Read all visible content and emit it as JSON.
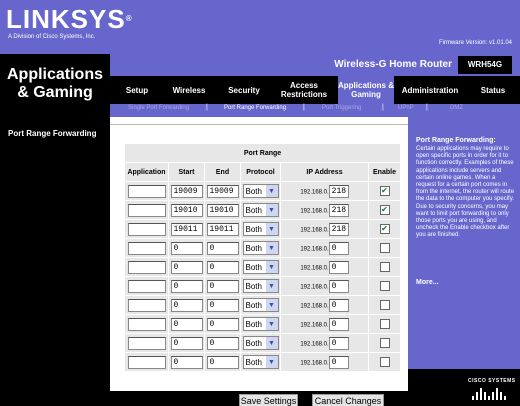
{
  "brand": {
    "logo_text": "LINKSYS",
    "registered": "®",
    "subtitle": "A Division of Cisco Systems, Inc.",
    "firmware": "Firmware Version: v1.01.04"
  },
  "product": {
    "name": "Wireless-G Home Router",
    "model": "WRH54G"
  },
  "section_title": "Applications & Gaming",
  "tabs": [
    {
      "label": "Setup"
    },
    {
      "label": "Wireless"
    },
    {
      "label": "Security"
    },
    {
      "label": "Access Restrictions"
    },
    {
      "label": "Applications & Gaming",
      "active": true
    },
    {
      "label": "Administration"
    },
    {
      "label": "Status"
    }
  ],
  "subtabs": [
    {
      "label": "Single Port Forwarding"
    },
    {
      "label": "Port Range Forwarding",
      "active": true
    },
    {
      "label": "Port Triggering"
    },
    {
      "label": "UPnP"
    },
    {
      "label": "DMZ"
    }
  ],
  "sidebar_label": "Port Range Forwarding",
  "table": {
    "caption": "Port Range",
    "headers": [
      "Application",
      "Start",
      "End",
      "Protocol",
      "IP Address",
      "Enable"
    ],
    "ip_prefix": "192.168.0.",
    "rows": [
      {
        "application": "",
        "start": "19009",
        "end": "19009",
        "protocol": "Both",
        "ip_last": "218",
        "enabled": true
      },
      {
        "application": "",
        "start": "19010",
        "end": "19010",
        "protocol": "Both",
        "ip_last": "218",
        "enabled": true
      },
      {
        "application": "",
        "start": "19011",
        "end": "19011",
        "protocol": "Both",
        "ip_last": "218",
        "enabled": true
      },
      {
        "application": "",
        "start": "0",
        "end": "0",
        "protocol": "Both",
        "ip_last": "0",
        "enabled": false
      },
      {
        "application": "",
        "start": "0",
        "end": "0",
        "protocol": "Both",
        "ip_last": "0",
        "enabled": false
      },
      {
        "application": "",
        "start": "0",
        "end": "0",
        "protocol": "Both",
        "ip_last": "0",
        "enabled": false
      },
      {
        "application": "",
        "start": "0",
        "end": "0",
        "protocol": "Both",
        "ip_last": "0",
        "enabled": false
      },
      {
        "application": "",
        "start": "0",
        "end": "0",
        "protocol": "Both",
        "ip_last": "0",
        "enabled": false
      },
      {
        "application": "",
        "start": "0",
        "end": "0",
        "protocol": "Both",
        "ip_last": "0",
        "enabled": false
      },
      {
        "application": "",
        "start": "0",
        "end": "0",
        "protocol": "Both",
        "ip_last": "0",
        "enabled": false
      }
    ]
  },
  "help": {
    "title": "Port Range Forwarding:",
    "text": "Certain applications may require to open specific ports in order for it to function correctly. Examples of these applications include servers and certain online games. When a request for a certain port comes in from the internet, the router will route the data to the computer you specify. Due to security concerns, you may want to limit port forwarding to only those ports you are using, and uncheck the Enable checkbox after you are finished.",
    "more": "More..."
  },
  "cisco_text": "CISCO SYSTEMS",
  "buttons": {
    "save": "Save Settings",
    "cancel": "Cancel Changes"
  },
  "colors": {
    "brand_purple": "#6666cc",
    "nav_black": "#000000",
    "cell_gray": "#e7e7e7"
  }
}
